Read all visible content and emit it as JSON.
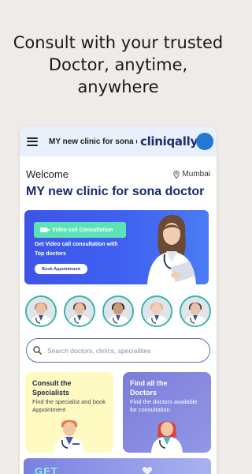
{
  "promo": {
    "line1": "Consult with your trusted",
    "line2": "Doctor, anytime,",
    "line3": "anywhere"
  },
  "appbar": {
    "title": "MY new clinic for sona doctor",
    "logo": "cliniqally",
    "menu_icon": "hamburger-icon",
    "avatar_color": "#2478d4"
  },
  "home": {
    "welcome": "Welcome",
    "location": "Mumbai",
    "clinic_title": "MY new clinic for sona doctor"
  },
  "banner": {
    "tag": "Video call Consultation",
    "text": "Get Video call consultation with Top doctors",
    "button": "Book Appointment"
  },
  "doctors": [
    {
      "name": "doctor-1",
      "coat": "#ffffff",
      "skin": "#e8c0a8",
      "hair": "#b88a66"
    },
    {
      "name": "doctor-2",
      "coat": "#ffffff",
      "skin": "#e6bfa3",
      "hair": "#5a4636"
    },
    {
      "name": "doctor-3",
      "coat": "#ffffff",
      "skin": "#c79a7c",
      "hair": "#2c241f"
    },
    {
      "name": "doctor-4",
      "coat": "#ffffff",
      "skin": "#efcdb8",
      "hair": "#d9b48a"
    },
    {
      "name": "doctor-5",
      "coat": "#ffffff",
      "skin": "#e8c2a6",
      "hair": "#4a3a2c"
    }
  ],
  "search": {
    "placeholder": "Search doctors, clinics, specialities"
  },
  "cards": {
    "specialists": {
      "title": "Consult the Specialists",
      "subtitle": "Find the specialist and book Appointment"
    },
    "doctors": {
      "title": "Find all the Doctors",
      "subtitle": "Find the doctors available for consultation"
    }
  },
  "bottom_banner": {
    "text": "GET"
  },
  "colors": {
    "brand_navy": "#1e2d6b",
    "banner_blue": "#3d55e6",
    "accent_green": "#5be3b7",
    "ring_teal": "#36b7a6"
  }
}
